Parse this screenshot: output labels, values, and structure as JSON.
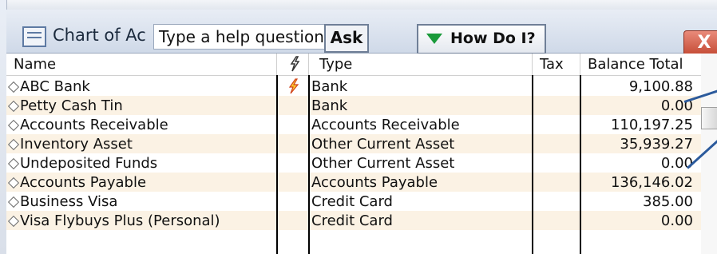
{
  "window": {
    "title": "Chart of Ac",
    "help_placeholder": "Type a help question",
    "ask_label": "Ask",
    "howdoi_label": "How Do I?",
    "close_label": "X"
  },
  "table": {
    "headers": {
      "name": "Name",
      "type": "Type",
      "tax": "Tax",
      "balance": "Balance Total"
    },
    "rows": [
      {
        "name": "ABC Bank",
        "type": "Bank",
        "balance": "9,100.88"
      },
      {
        "name": "Petty Cash Tin",
        "type": "Bank",
        "balance": "0.00"
      },
      {
        "name": "Accounts Receivable",
        "type": "Accounts Receivable",
        "balance": "110,197.25"
      },
      {
        "name": "Inventory Asset",
        "type": "Other Current Asset",
        "balance": "35,939.27"
      },
      {
        "name": "Undeposited Funds",
        "type": "Other Current Asset",
        "balance": "0.00"
      },
      {
        "name": "Accounts Payable",
        "type": "Accounts Payable",
        "balance": "136,146.02"
      },
      {
        "name": "Business Visa",
        "type": "Credit Card",
        "balance": "385.00"
      },
      {
        "name": "Visa Flybuys Plus (Personal)",
        "type": "Credit Card",
        "balance": "0.00"
      }
    ]
  },
  "colors": {
    "alt_row": "#fbf2e4",
    "annotation_line": "#2b5a9c",
    "howdoi_arrow": "#1a9a3a",
    "close_button": "#c44a34"
  }
}
